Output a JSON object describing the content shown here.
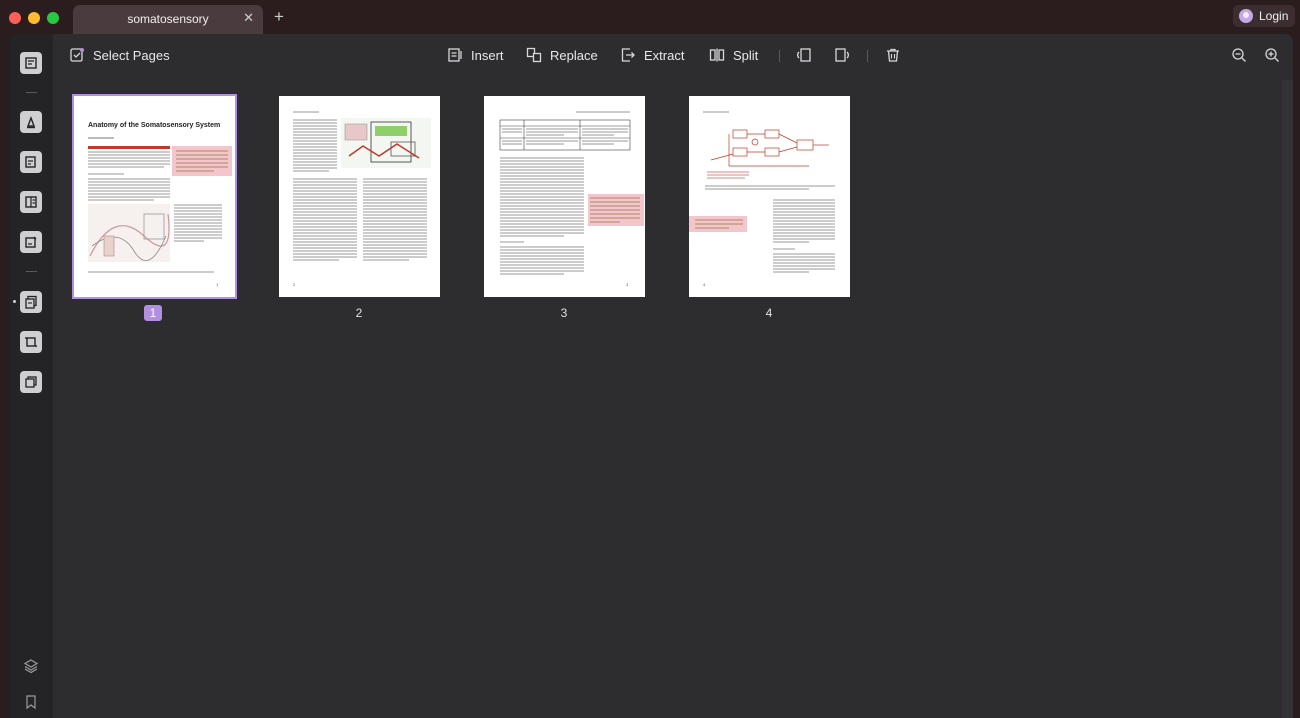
{
  "window": {
    "tab_title": "somatosensory",
    "close_tab_glyph": "✕",
    "new_tab_glyph": "+",
    "login_label": "Login"
  },
  "toolbar": {
    "select_pages_label": "Select Pages",
    "insert_label": "Insert",
    "replace_label": "Replace",
    "extract_label": "Extract",
    "split_label": "Split"
  },
  "pages": [
    {
      "number": "1",
      "selected": true,
      "title": "Anatomy of the Somatosensory System"
    },
    {
      "number": "2",
      "selected": false
    },
    {
      "number": "3",
      "selected": false
    },
    {
      "number": "4",
      "selected": false
    }
  ],
  "colors": {
    "accent": "#b28fe0",
    "highlight": "#f4c6cc",
    "red_mark": "#c0392b"
  }
}
